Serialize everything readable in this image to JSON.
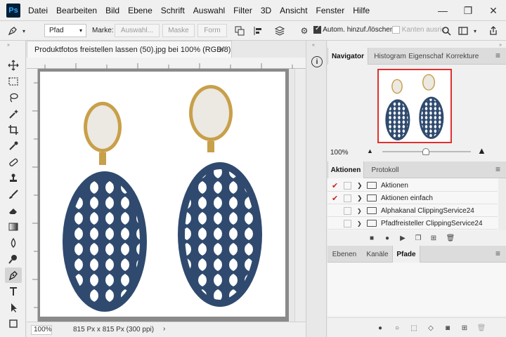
{
  "app": {
    "logo": "Ps"
  },
  "menu": [
    "Datei",
    "Bearbeiten",
    "Bild",
    "Ebene",
    "Schrift",
    "Auswahl",
    "Filter",
    "3D",
    "Ansicht",
    "Fenster",
    "Hilfe"
  ],
  "options": {
    "mode": "Pfad",
    "make_label": "Marke:",
    "selection_btn": "Auswahl...",
    "mask_btn": "Maske",
    "shape_btn": "Form",
    "auto_add_label": "Autom. hinzuf./löschen",
    "align_edges_label": "Kanten ausric"
  },
  "document": {
    "tab_title": "Produktfotos freistellen lassen (50).jpg bei 100% (RGB/8)",
    "zoom": "100%",
    "dimensions": "815 Px x 815 Px (300 ppi)"
  },
  "panels": {
    "navigator_tabs": [
      "Navigator",
      "Histogram",
      "Eigenschaf",
      "Korrekture"
    ],
    "navigator_zoom": "100%",
    "actions_tabs": [
      "Aktionen",
      "Protokoll"
    ],
    "actions": [
      {
        "label": "Aktionen",
        "checked": true,
        "expanded": false
      },
      {
        "label": "Aktionen einfach",
        "checked": true,
        "expanded": false
      },
      {
        "label": "Alphakanal ClippingService24",
        "checked": false,
        "expanded": true
      },
      {
        "label": "Pfadfreisteller ClippingService24",
        "checked": false,
        "expanded": true
      }
    ],
    "layers_tabs": [
      "Ebenen",
      "Kanäle",
      "Pfade"
    ]
  },
  "colors": {
    "earring_blue": "#2f4a6e",
    "gold": "#c8a04a",
    "pearl": "#ece8e2",
    "navigator_frame": "#e03030"
  }
}
